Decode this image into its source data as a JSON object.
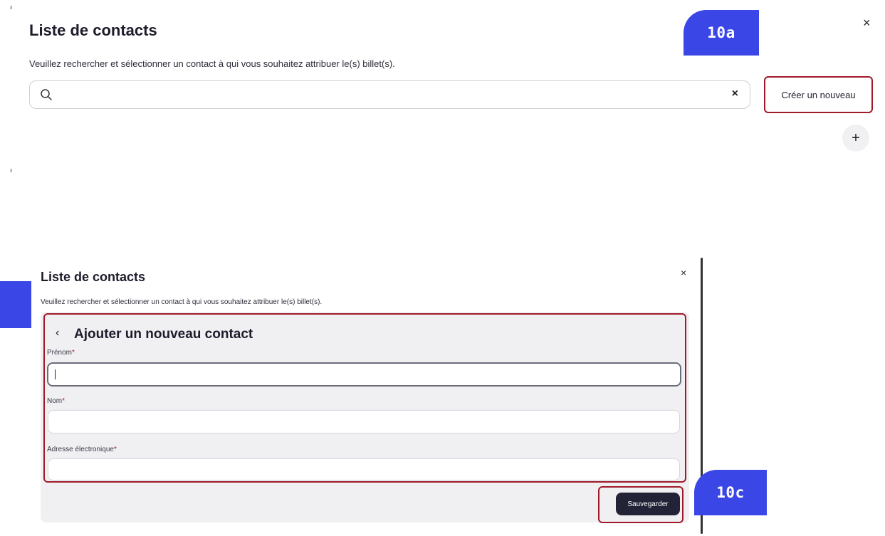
{
  "top_panel": {
    "title": "Liste de contacts",
    "subtitle": "Veuillez rechercher et sélectionner un contact à qui vous souhaitez attribuer le(s) billet(s).",
    "search_value": "",
    "clear_icon": "×",
    "create_label": "Créer un nouveau",
    "plus_label": "+",
    "close_label": "×",
    "badge": "10a"
  },
  "dialog": {
    "title": "Liste de contacts",
    "subtitle": "Veuillez rechercher et sélectionner un contact à qui vous souhaitez attribuer le(s) billet(s).",
    "close_label": "×",
    "back_icon": "‹",
    "form_title": "Ajouter un nouveau contact",
    "fields": [
      {
        "label": "Prénom",
        "required": "*",
        "value": ""
      },
      {
        "label": "Nom",
        "required": "*",
        "value": ""
      },
      {
        "label": "Adresse électronique",
        "required": "*",
        "value": ""
      }
    ],
    "save_label": "Sauvegarder",
    "badge": "10c"
  },
  "colors": {
    "accent_badge": "#3b46e6",
    "highlight_frame": "#a11a2a",
    "primary_button": "#232338",
    "required": "#b3122a"
  }
}
